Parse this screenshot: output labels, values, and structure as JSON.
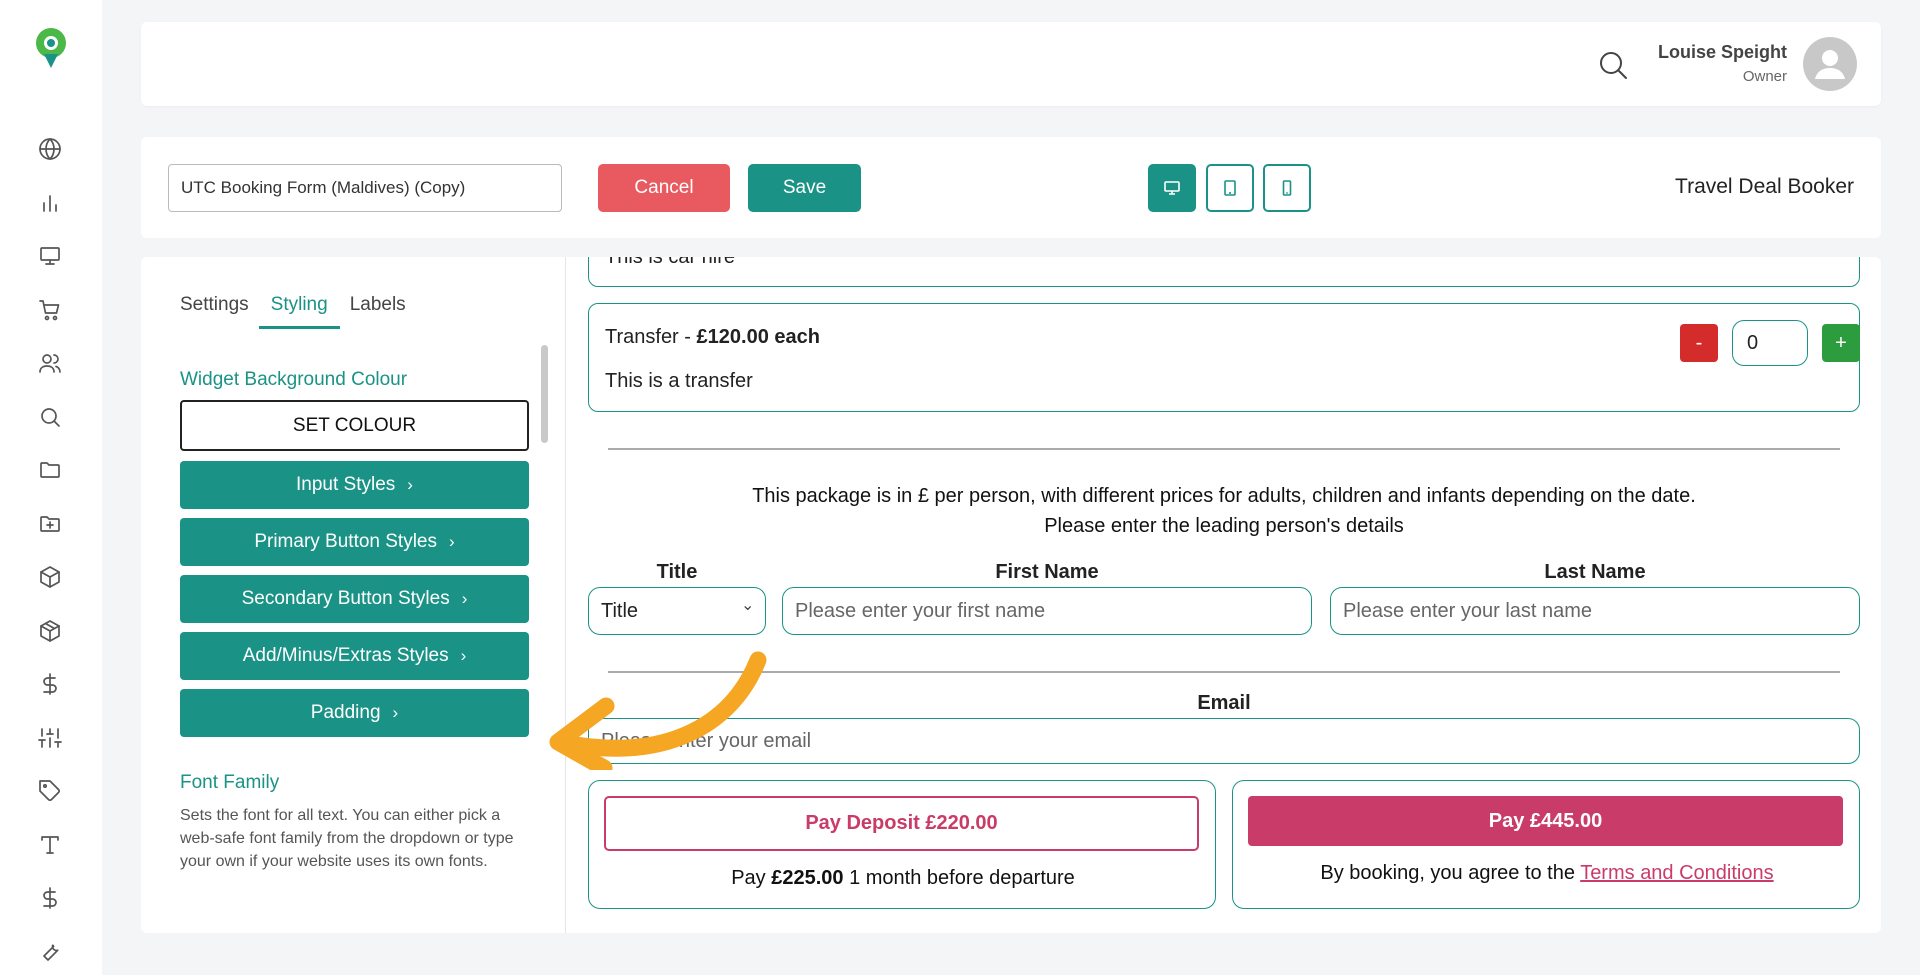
{
  "header": {
    "user_name": "Louise Speight",
    "user_role": "Owner"
  },
  "toolbar": {
    "form_name": "UTC Booking Form (Maldives) (Copy)",
    "cancel_label": "Cancel",
    "save_label": "Save",
    "app_title": "Travel Deal Booker"
  },
  "panel": {
    "tabs": [
      "Settings",
      "Styling",
      "Labels"
    ],
    "active_tab": "Styling",
    "bg_section_title": "Widget Background Colour",
    "set_colour_label": "SET COLOUR",
    "style_buttons": [
      "Input Styles",
      "Primary Button Styles",
      "Secondary Button Styles",
      "Add/Minus/Extras Styles",
      "Padding"
    ],
    "font_section_title": "Font Family",
    "font_description": "Sets the font for all text. You can either pick a web-safe font family from the dropdown or type your own if your website uses its own fonts."
  },
  "preview": {
    "car_hire_desc": "This is car hire",
    "transfer": {
      "name": "Transfer",
      "price": "£120.00 each",
      "desc": "This is a transfer",
      "minus": "-",
      "qty": "0",
      "plus": "+"
    },
    "notice_line1": "This package is in £ per person, with different prices for adults, children and infants depending on the date.",
    "notice_line2": "Please enter the leading person's details",
    "title_label": "Title",
    "title_value": "Title",
    "first_name_label": "First Name",
    "first_name_placeholder": "Please enter your first name",
    "last_name_label": "Last Name",
    "last_name_placeholder": "Please enter your last name",
    "email_label": "Email",
    "email_placeholder": "Please enter your email",
    "deposit_button": "Pay Deposit £220.00",
    "deposit_note_prefix": "Pay",
    "deposit_note_amount": "£225.00",
    "deposit_note_suffix": "1 month before departure",
    "pay_button": "Pay £445.00",
    "agree_prefix": "By booking, you agree to the",
    "terms_link": "Terms and Conditions"
  },
  "colors": {
    "brand_teal": "#1a9386",
    "cancel_red": "#e85a5f",
    "pay_pink": "#c93b68",
    "annotation_arrow": "#f5a623"
  }
}
